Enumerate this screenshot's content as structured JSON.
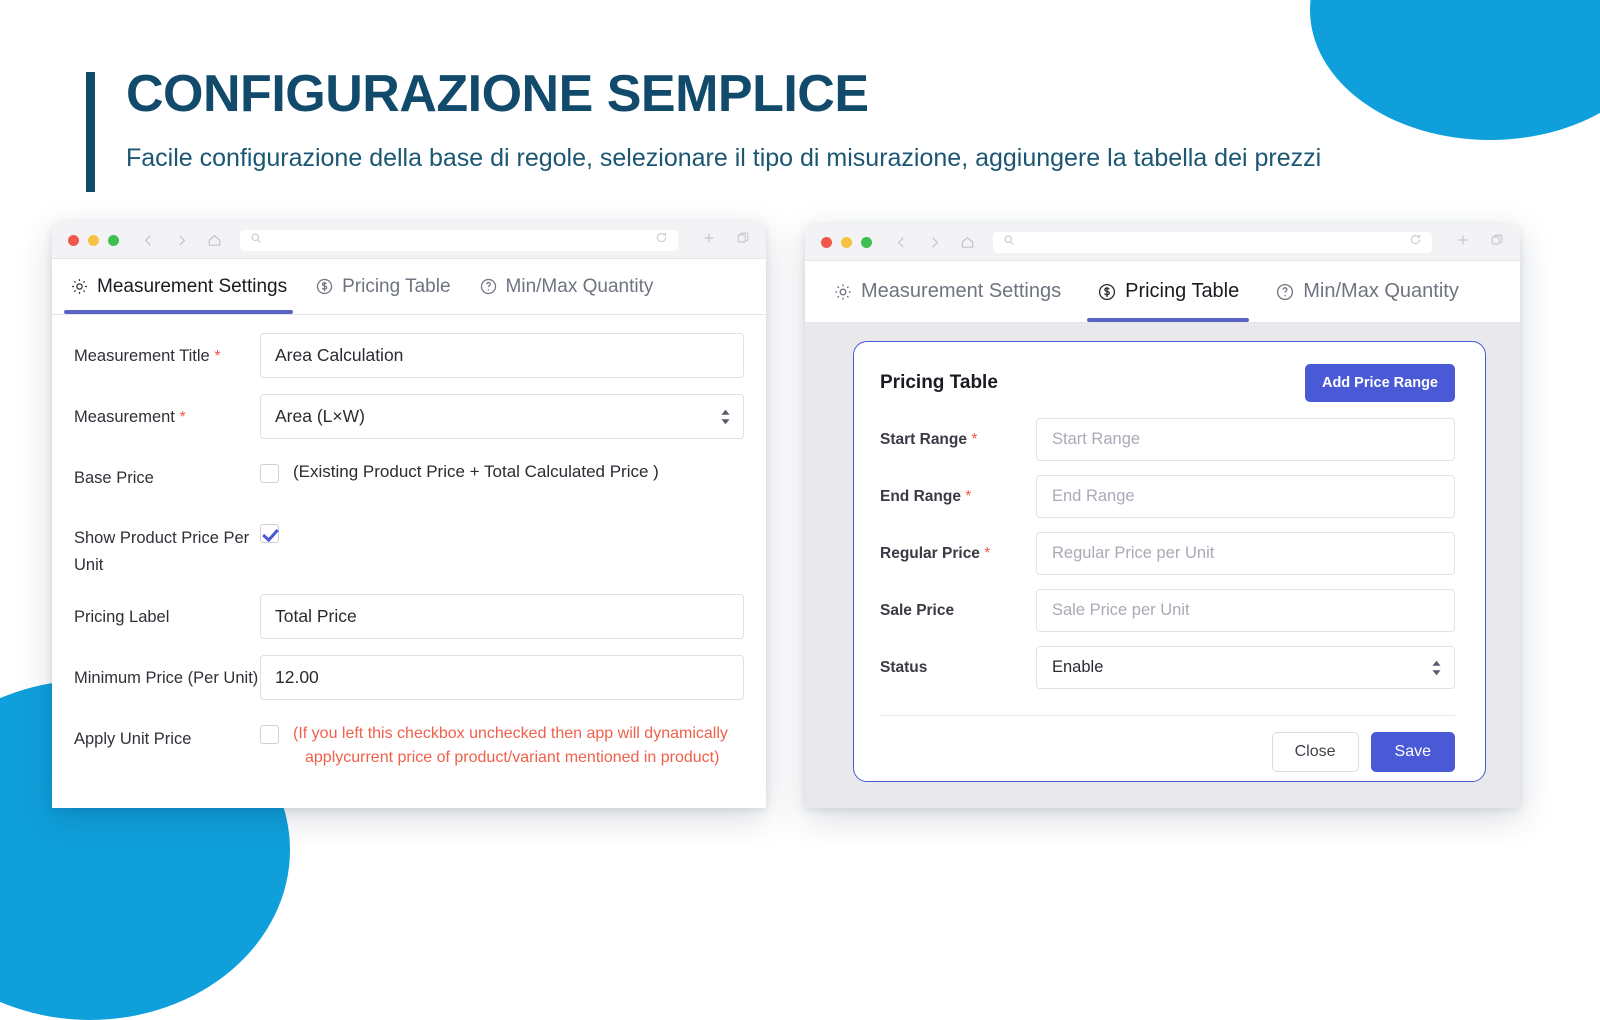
{
  "header": {
    "title": "CONFIGURAZIONE SEMPLICE",
    "subtitle": "Facile configurazione della base di regole, selezionare il tipo di misurazione, aggiungere la tabella dei prezzi",
    "accent_color": "#114a6b"
  },
  "decor": {
    "shape_color": "#0f9fdb"
  },
  "left_window": {
    "chrome": {
      "back_icon": "arrow-left-icon",
      "forward_icon": "arrow-right-icon",
      "home_icon": "home-icon",
      "search_icon": "search-icon",
      "reload_icon": "reload-icon",
      "new_tab_icon": "plus-icon",
      "tabs_icon": "copy-icon",
      "url_value": ""
    },
    "tabs": [
      {
        "label": "Measurement Settings",
        "icon": "gear-icon",
        "active": true
      },
      {
        "label": "Pricing Table",
        "icon": "dollar-circle-icon",
        "active": false
      },
      {
        "label": "Min/Max Quantity",
        "icon": "question-circle-icon",
        "active": false
      }
    ],
    "active_tab_color": "#5a63c4",
    "fields": {
      "measurement_title": {
        "label": "Measurement Title",
        "required": "*",
        "value": "Area Calculation"
      },
      "measurement": {
        "label": "Measurement",
        "required": "*",
        "value": "Area (L×W)"
      },
      "base_price": {
        "label": "Base Price",
        "checked": false,
        "note": "(Existing Product Price + Total Calculated Price )"
      },
      "show_product_price_per_unit": {
        "label": "Show Product Price Per Unit",
        "checked": true
      },
      "pricing_label": {
        "label": "Pricing Label",
        "value": "Total Price"
      },
      "minimum_price": {
        "label": "Minimum Price (Per Unit)",
        "value": "12.00"
      },
      "apply_unit_price": {
        "label": "Apply Unit Price",
        "checked": false,
        "note_line1": "(If you left this checkbox unchecked then app will dynamically",
        "note_line2": "applycurrent price of product/variant mentioned in product)",
        "note_color": "#f0604b"
      }
    }
  },
  "right_window": {
    "chrome": {
      "back_icon": "arrow-left-icon",
      "forward_icon": "arrow-right-icon",
      "home_icon": "home-icon",
      "search_icon": "search-icon",
      "reload_icon": "reload-icon",
      "new_tab_icon": "plus-icon",
      "tabs_icon": "copy-icon",
      "url_value": ""
    },
    "tabs": [
      {
        "label": "Measurement Settings",
        "icon": "gear-icon",
        "active": false
      },
      {
        "label": "Pricing Table",
        "icon": "dollar-circle-icon",
        "active": true
      },
      {
        "label": "Min/Max Quantity",
        "icon": "question-circle-icon",
        "active": false
      }
    ],
    "card": {
      "title": "Pricing Table",
      "add_button": "Add Price Range",
      "border_color": "#4a5ad6",
      "fields": {
        "start_range": {
          "label": "Start Range",
          "required": "*",
          "placeholder": "Start Range",
          "value": ""
        },
        "end_range": {
          "label": "End Range",
          "required": "*",
          "placeholder": "End Range",
          "value": ""
        },
        "regular_price": {
          "label": "Regular Price",
          "required": "*",
          "placeholder": "Regular Price per Unit",
          "value": ""
        },
        "sale_price": {
          "label": "Sale Price",
          "required": "",
          "placeholder": "Sale Price per Unit",
          "value": ""
        },
        "status": {
          "label": "Status",
          "required": "",
          "value": "Enable"
        }
      },
      "close_button": "Close",
      "save_button": "Save"
    }
  }
}
